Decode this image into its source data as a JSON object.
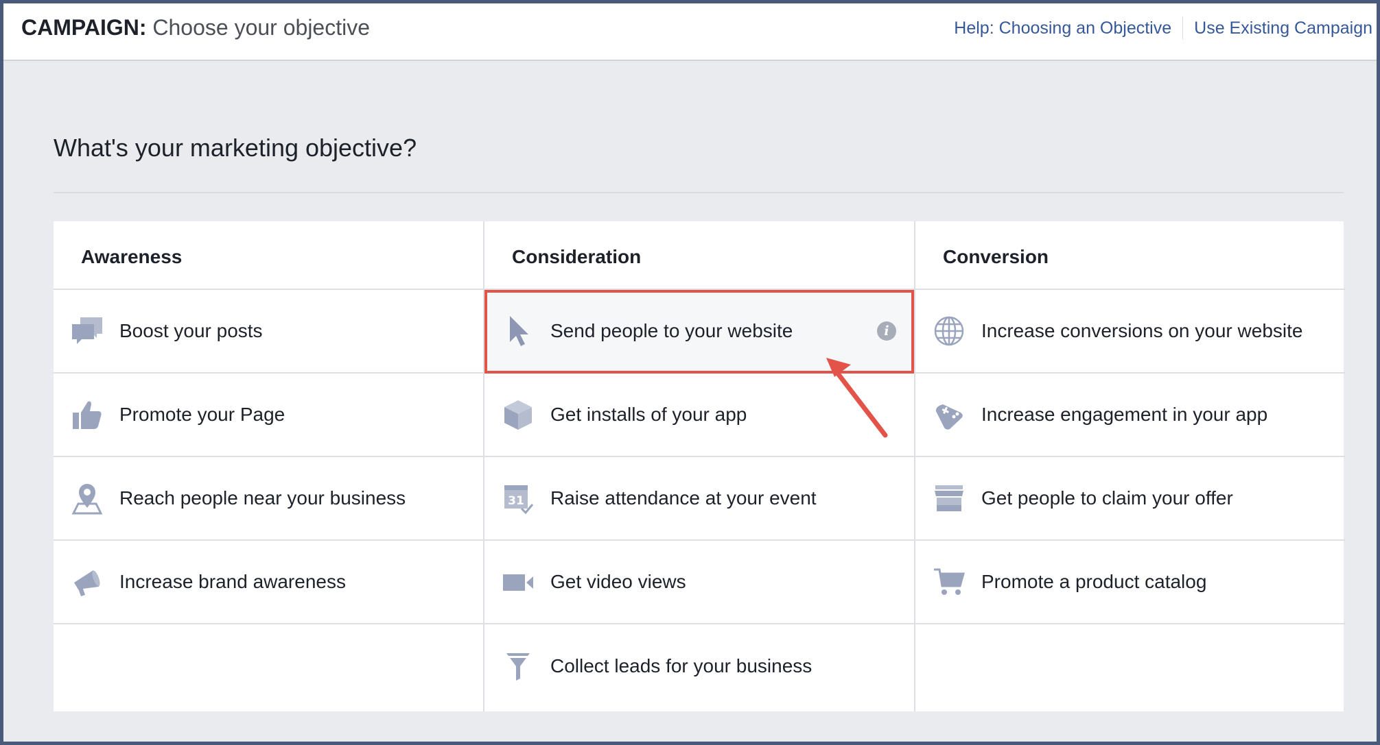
{
  "header": {
    "title_prefix": "CAMPAIGN:",
    "title_rest": "Choose your objective",
    "links": {
      "help": "Help: Choosing an Objective",
      "existing": "Use Existing Campaign"
    }
  },
  "main": {
    "heading": "What's your marketing objective?"
  },
  "columns": {
    "awareness": {
      "title": "Awareness",
      "items": [
        {
          "label": "Boost your posts",
          "icon": "speech-bubbles-icon"
        },
        {
          "label": "Promote your Page",
          "icon": "thumbs-up-icon"
        },
        {
          "label": "Reach people near your business",
          "icon": "map-pin-icon"
        },
        {
          "label": "Increase brand awareness",
          "icon": "megaphone-icon"
        }
      ]
    },
    "consideration": {
      "title": "Consideration",
      "items": [
        {
          "label": "Send people to your website",
          "icon": "cursor-icon",
          "selected": true
        },
        {
          "label": "Get installs of your app",
          "icon": "box-icon"
        },
        {
          "label": "Raise attendance at your event",
          "icon": "calendar-icon"
        },
        {
          "label": "Get video views",
          "icon": "video-camera-icon"
        },
        {
          "label": "Collect leads for your business",
          "icon": "funnel-icon"
        }
      ]
    },
    "conversion": {
      "title": "Conversion",
      "items": [
        {
          "label": "Increase conversions on your website",
          "icon": "globe-icon"
        },
        {
          "label": "Increase engagement in your app",
          "icon": "gamepad-icon"
        },
        {
          "label": "Get people to claim your offer",
          "icon": "storefront-icon"
        },
        {
          "label": "Promote a product catalog",
          "icon": "shopping-cart-icon"
        }
      ]
    }
  },
  "colors": {
    "icon": "#9aa4bd",
    "link": "#365899",
    "highlight": "#e2534a",
    "background": "#e9ebee"
  }
}
